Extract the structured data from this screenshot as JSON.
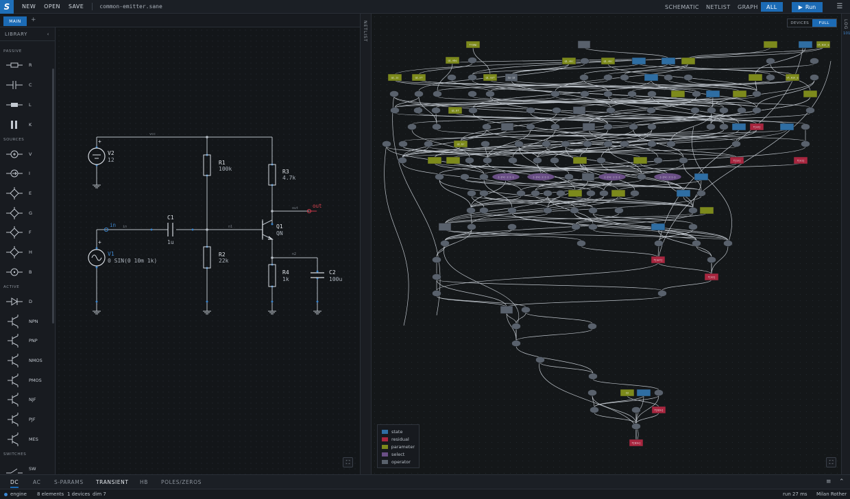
{
  "app": {
    "file_name": "common-emitter.sane",
    "menu": {
      "new": "NEW",
      "open": "OPEN",
      "save": "SAVE"
    },
    "views": {
      "schematic": "SCHEMATIC",
      "netlist": "NETLIST",
      "graph": "GRAPH",
      "all": "ALL"
    },
    "run_label": "Run",
    "brand_color": "#1c6bb5"
  },
  "tabs": {
    "main": "MAIN",
    "add": "+"
  },
  "library": {
    "title": "LIBRARY",
    "collapse": "‹",
    "groups": {
      "passive": "PASSIVE",
      "sources": "SOURCES",
      "active": "ACTIVE",
      "switches": "SWITCHES"
    },
    "items": [
      {
        "label": "R",
        "icon": "resistor-icon"
      },
      {
        "label": "C",
        "icon": "capacitor-icon"
      },
      {
        "label": "L",
        "icon": "inductor-icon"
      },
      {
        "label": "K",
        "icon": "coupling-icon"
      },
      {
        "label": "V",
        "icon": "voltage-source-icon"
      },
      {
        "label": "I",
        "icon": "current-source-icon"
      },
      {
        "label": "E",
        "icon": "vcvs-icon"
      },
      {
        "label": "G",
        "icon": "vccs-icon"
      },
      {
        "label": "F",
        "icon": "cccs-icon"
      },
      {
        "label": "H",
        "icon": "ccvs-icon"
      },
      {
        "label": "B",
        "icon": "behavioral-source-icon"
      },
      {
        "label": "D",
        "icon": "diode-icon"
      },
      {
        "label": "NPN",
        "icon": "npn-icon"
      },
      {
        "label": "PNP",
        "icon": "pnp-icon"
      },
      {
        "label": "NMOS",
        "icon": "nmos-icon"
      },
      {
        "label": "PMOS",
        "icon": "pmos-icon"
      },
      {
        "label": "NJF",
        "icon": "njf-icon"
      },
      {
        "label": "PJF",
        "icon": "pjf-icon"
      },
      {
        "label": "MES",
        "icon": "mesfet-icon"
      },
      {
        "label": "SW",
        "icon": "switch-icon"
      }
    ]
  },
  "schematic": {
    "nets": {
      "vcc": "vcc",
      "in": "in",
      "n1": "n1",
      "n2": "n2",
      "out": "out"
    },
    "probes": {
      "in": "in",
      "out": "out"
    },
    "components": {
      "V2": {
        "name": "V2",
        "value": "12"
      },
      "R1": {
        "name": "R1",
        "value": "100k"
      },
      "R3": {
        "name": "R3",
        "value": "4.7k"
      },
      "C1": {
        "name": "C1",
        "value": "1u"
      },
      "Q1": {
        "name": "Q1",
        "value": "QN"
      },
      "R2": {
        "name": "R2",
        "value": "22k"
      },
      "V1": {
        "name": "V1",
        "value": "0 SIN(0 10m 1k)"
      },
      "R4": {
        "name": "R4",
        "value": "1k"
      },
      "C2": {
        "name": "C2",
        "value": "100u"
      }
    },
    "plus": "+"
  },
  "netlist_tab": "NETLIST",
  "log_tab": "LOG",
  "log_count": "101",
  "graph": {
    "toggle": {
      "devices": "DEVICES",
      "full": "FULL"
    },
    "colors": {
      "state": "#2f6ea3",
      "residual": "#a8263f",
      "parameter": "#7d8a1c",
      "select": "#6a4f86",
      "operator": "#59616c"
    },
    "legend": [
      {
        "label": "state",
        "color": "#2f6ea3"
      },
      {
        "label": "residual",
        "color": "#a8263f"
      },
      {
        "label": "parameter",
        "color": "#7d8a1c"
      },
      {
        "label": "select",
        "color": "#6a4f86"
      },
      {
        "label": "operator",
        "color": "#59616c"
      }
    ],
    "labels": {
      "tramp": "Tramp",
      "qvbe": "q1.vbe",
      "qvbc": "q1.vbc",
      "qis": "q1.is",
      "qbf": "q1.bf",
      "qnf": "q1.nf",
      "qvaf": "q1.vaf",
      "qbr": "q1.br",
      "vt": "vt.min_e",
      "vcc": "v[vcc]",
      "vin": "v[in]",
      "vn1": "v[n1]",
      "vout": "v[out]",
      "vn2": "v[n2]",
      "fvcc": "f[v2]",
      "fin": "f[in]",
      "fn1": "f[n1]",
      "fout": "f[out]",
      "fn2": "f[n2]",
      "fvb": "f[Q1v]",
      "i2": "I2",
      "i1": "I1",
      "s1": "S",
      "e1": "exp",
      "k": "1e-12",
      "gmin": "1e-12",
      "n": "2",
      "m": "-1",
      "sel": "(-)>(-):(-)"
    }
  },
  "analysis_tabs": [
    "DC",
    "AC",
    "S-PARAMS",
    "TRANSIENT",
    "HB",
    "POLES/ZEROS"
  ],
  "status": {
    "engine": "engine",
    "elements": "8 elements",
    "devices": "1 devices",
    "dim": "dim 7",
    "run_time": "run 27 ms",
    "author": "Milan Rother"
  }
}
